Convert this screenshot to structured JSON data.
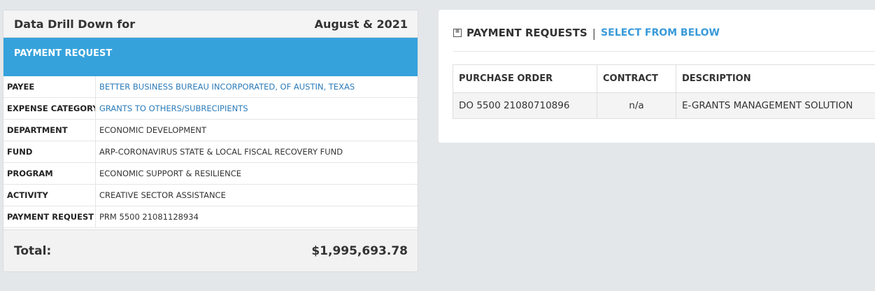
{
  "drilldown": {
    "title": "Data Drill Down for",
    "period": "August & 2021",
    "banner": "PAYMENT REQUEST",
    "rows": [
      {
        "label": "PAYEE",
        "value": "BETTER BUSINESS BUREAU INCORPORATED, OF AUSTIN, TEXAS",
        "link": true
      },
      {
        "label": "EXPENSE CATEGORY",
        "value": "GRANTS TO OTHERS/SUBRECIPIENTS",
        "link": true
      },
      {
        "label": "DEPARTMENT",
        "value": "ECONOMIC DEVELOPMENT",
        "link": false
      },
      {
        "label": "FUND",
        "value": "ARP-CORONAVIRUS STATE & LOCAL FISCAL RECOVERY FUND",
        "link": false
      },
      {
        "label": "PROGRAM",
        "value": "ECONOMIC SUPPORT & RESILIENCE",
        "link": false
      },
      {
        "label": "ACTIVITY",
        "value": "CREATIVE SECTOR ASSISTANCE",
        "link": false
      },
      {
        "label": "PAYMENT REQUEST",
        "value": "PRM 5500 21081128934",
        "link": false
      }
    ],
    "total_label": "Total:",
    "total_value": "$1,995,693.78"
  },
  "payment_requests": {
    "icon": "form-icon",
    "title": "PAYMENT REQUESTS",
    "separator": "|",
    "subtitle": "SELECT FROM BELOW",
    "columns": [
      "PURCHASE ORDER",
      "CONTRACT",
      "DESCRIPTION"
    ],
    "rows": [
      [
        "DO 5500 21080710896",
        "n/a",
        "E-GRANTS MANAGEMENT SOLUTION"
      ]
    ]
  },
  "colors": {
    "banner": "#36a2dc",
    "link": "#2b7bb9",
    "accent": "#3a9ad9"
  }
}
